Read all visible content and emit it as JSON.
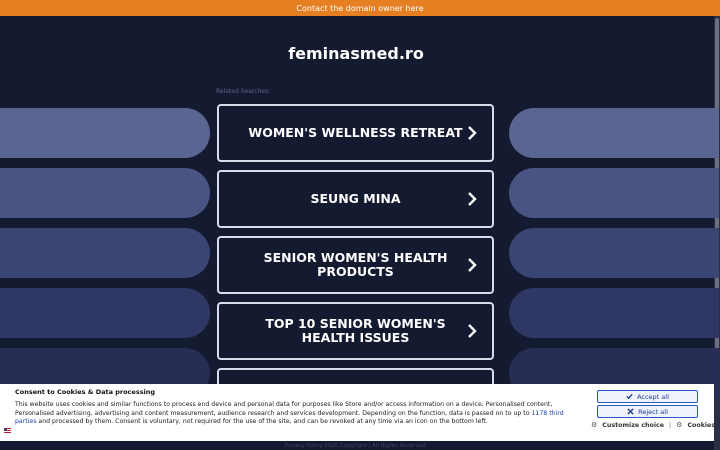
{
  "topbar": {
    "label": "Contact the domain owner here"
  },
  "domain": {
    "name": "feminasmed.ro"
  },
  "related": {
    "label": "Related Searches:"
  },
  "links": [
    {
      "label": "WOMEN'S WELLNESS RETREAT"
    },
    {
      "label": "SEUNG MINA"
    },
    {
      "label": "SENIOR WOMEN'S HEALTH PRODUCTS"
    },
    {
      "label": "TOP 10 SENIOR WOMEN'S HEALTH ISSUES"
    },
    {
      "label": ""
    }
  ],
  "cookie": {
    "title": "Consent to Cookies & Data processing",
    "text_before": "This website uses cookies and similar functions to process end device and personal data for purposes like Store and/or access information on a device, Personalised content, Personalised advertising, advertising and content measurement, audience research and services development. Depending on the function, data is passed on to up to ",
    "third_parties_link": "1178 third parties",
    "text_after": " and processed by them. Consent is voluntary, not required for the use of the site, and can be revoked at any time via an icon on the bottom left.",
    "accept_label": "Accept all",
    "reject_label": "Reject all",
    "customize_label": "Customize choice",
    "separator": "|",
    "cookies_label": "Cookies"
  },
  "footer": {
    "text": "Privacy Policy  2025 Copyright | All Rights Reserved."
  },
  "colors": {
    "accent": "#e67e22",
    "background": "#141a30",
    "button_blue": "#2b56c6"
  }
}
